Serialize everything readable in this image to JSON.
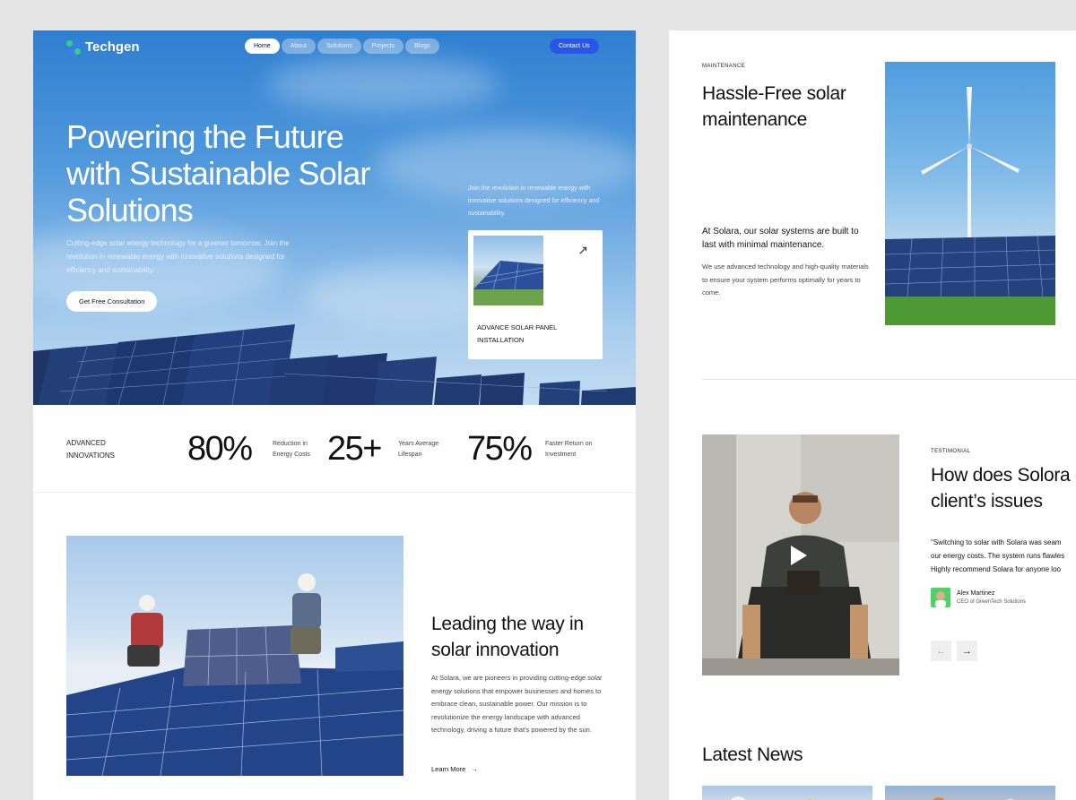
{
  "left_page": {
    "brand": "Techgen",
    "nav": [
      "Home",
      "About",
      "Solutions",
      "Projects",
      "Blogs"
    ],
    "contact_label": "Contact Us",
    "hero": {
      "title": "Powering the Future with Sustainable Solar Solutions",
      "subtitle": "Cutting-edge solar energy technology for a greener tomorrow. Join the revolution in renewable energy with innovative solutions designed for efficiency and sustainability.",
      "cta_label": "Get Free Consultation",
      "side_text": "Join the revolution in renewable energy with innovative solutions designed for efficiency and sustainability.",
      "card_label": "ADVANCE SOLAR PANEL INSTALLATION",
      "card_icon": "arrow-up-right-icon"
    },
    "stats": {
      "label": "ADVANCED INNOVATIONS",
      "items": [
        {
          "value": "80%",
          "desc": "Reduction in Energy Costs"
        },
        {
          "value": "25+",
          "desc": "Years Average Lifespan"
        },
        {
          "value": "75%",
          "desc": "Faster Return on Investment"
        }
      ]
    },
    "lead": {
      "title": "Leading the way in solar innovation",
      "text": "At Solara, we are pioneers in providing cutting-edge solar energy solutions that empower businesses and homes to embrace clean, sustainable power. Our mission is to revolutionize the energy landscape with advanced technology, driving a future that's powered by the sun.",
      "link_label": "Learn More"
    }
  },
  "right_page": {
    "maintenance": {
      "eyebrow": "MAINTENANCE",
      "title": "Hassle-Free solar maintenance",
      "lead": "At Solara, our solar systems are built to last with minimal maintenance.",
      "text": "We use advanced technology and high-quality materials to ensure your system performs optimally for years to come."
    },
    "testimonial": {
      "eyebrow": "TESTIMONIAL",
      "title": "How does Solora our client’s issues",
      "quote_lines": [
        "\"Switching to solar with Solara was seam",
        "our energy costs. The system runs flawles",
        "Highly recommend Solara for anyone loo"
      ],
      "author_name": "Alex Martinez",
      "author_role": "CEO of GreenTech Solutions",
      "prev_icon": "arrow-left-icon",
      "next_icon": "arrow-right-icon"
    },
    "news": {
      "title": "Latest News"
    }
  },
  "colors": {
    "accent": "#2a56e8",
    "sky": "#4f98dc",
    "panel": "#1f3a78"
  }
}
